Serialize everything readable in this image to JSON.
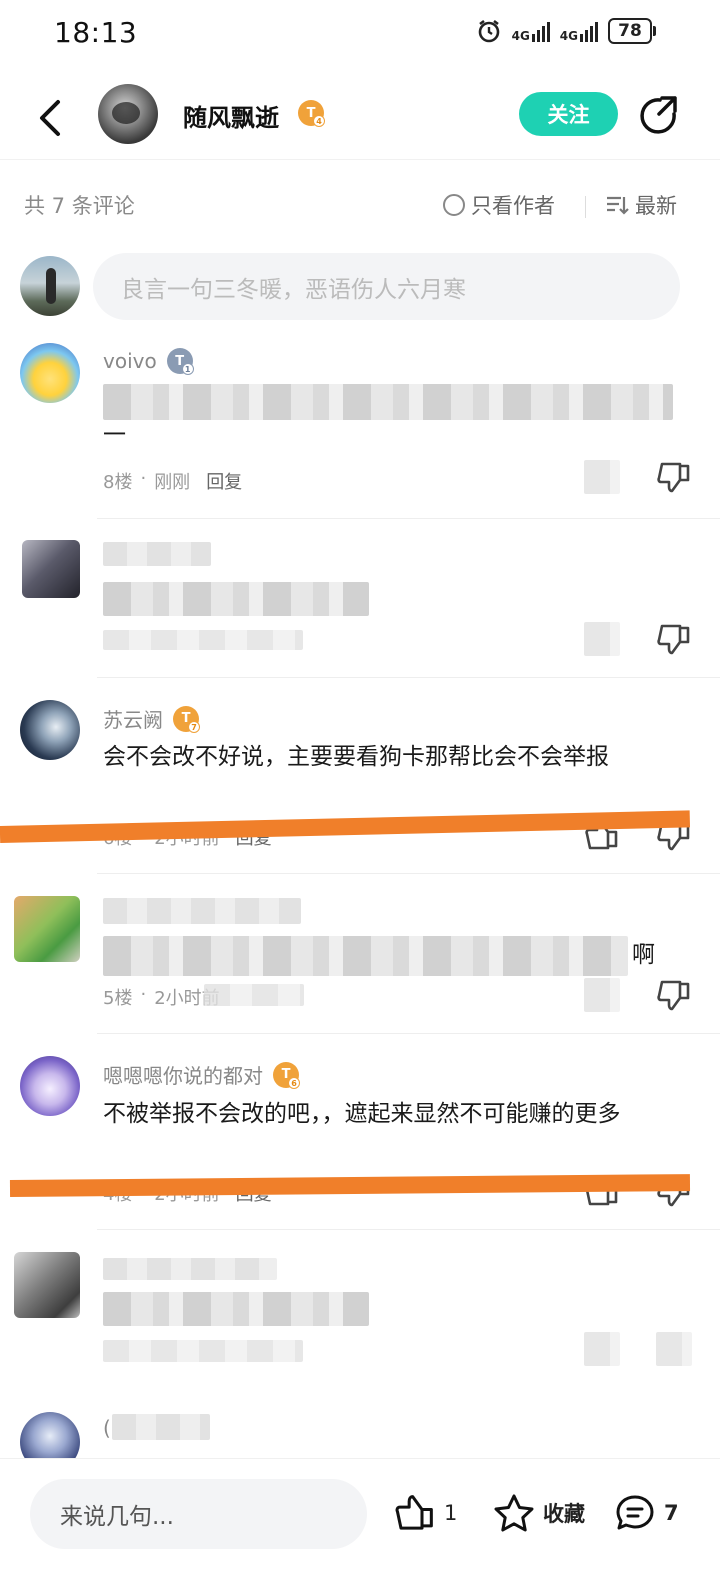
{
  "status_bar": {
    "time": "18:13",
    "network_1": "4G",
    "network_2": "4G",
    "battery": "78"
  },
  "header": {
    "username": "随风飘逝",
    "level": "T",
    "level_num": "4",
    "follow_label": "关注"
  },
  "comments_toolbar": {
    "count_text": "共 7 条评论",
    "author_only_label": "只看作者",
    "sort_label": "最新"
  },
  "composer": {
    "placeholder": "良言一句三冬暖，恶语伤人六月寒"
  },
  "comments": [
    {
      "name": "voivo",
      "level": "T",
      "level_num": "1",
      "text_tail": "一",
      "floor": "8楼",
      "time": "刚刚",
      "reply": "回复"
    },
    {
      "name": "",
      "level": "",
      "level_num": "",
      "text": "",
      "floor": "",
      "time": "",
      "reply": ""
    },
    {
      "name": "苏云阙",
      "level": "T",
      "level_num": "7",
      "text": "会不会改不好说，主要要看狗卡那帮比会不会举报",
      "floor": "6楼",
      "time": "2小时前",
      "reply": "回复"
    },
    {
      "name": "",
      "level": "",
      "level_num": "",
      "text_tail": "啊",
      "floor": "5楼",
      "time": "2小时前",
      "reply": ""
    },
    {
      "name": "嗯嗯嗯你说的都对",
      "level": "T",
      "level_num": "6",
      "text": "不被举报不会改的吧，，遮起来显然不可能赚的更多",
      "floor": "4楼",
      "time": "2小时前",
      "reply": "回复"
    },
    {
      "name": "",
      "text": ""
    },
    {
      "name": "(",
      "text": ""
    }
  ],
  "bottom_bar": {
    "placeholder": "来说几句...",
    "like_count": "1",
    "favorite_label": "收藏",
    "comment_count": "7"
  },
  "colors": {
    "accent": "#1ED1B3",
    "level_badge": "#F0A23A",
    "annotation_strike": "#F07F2A"
  }
}
